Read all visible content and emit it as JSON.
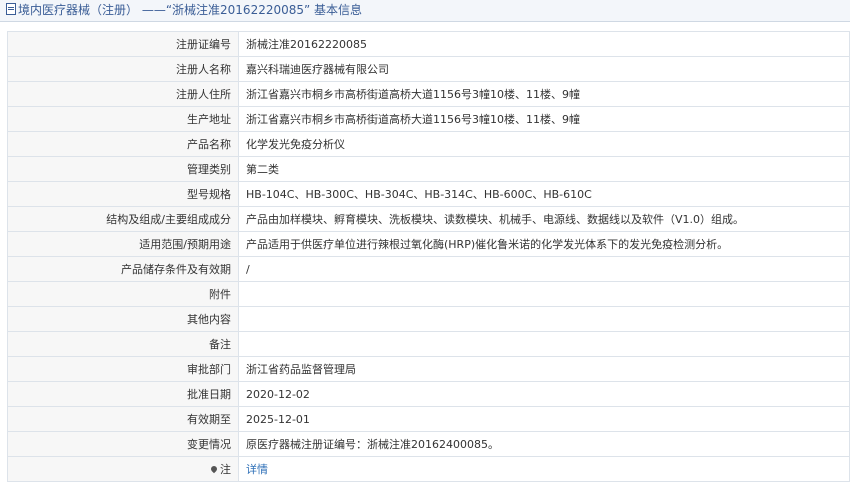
{
  "header": {
    "title": "境内医疗器械（注册） ——“浙械注准20162220085” 基本信息"
  },
  "rows": [
    {
      "label": "注册证编号",
      "value": "浙械注准20162220085"
    },
    {
      "label": "注册人名称",
      "value": "嘉兴科瑞迪医疗器械有限公司"
    },
    {
      "label": "注册人住所",
      "value": "浙江省嘉兴市桐乡市高桥街道高桥大道1156号3幢10楼、11楼、9幢"
    },
    {
      "label": "生产地址",
      "value": "浙江省嘉兴市桐乡市高桥街道高桥大道1156号3幢10楼、11楼、9幢"
    },
    {
      "label": "产品名称",
      "value": "化学发光免疫分析仪"
    },
    {
      "label": "管理类别",
      "value": "第二类"
    },
    {
      "label": "型号规格",
      "value": "HB-104C、HB-300C、HB-304C、HB-314C、HB-600C、HB-610C"
    },
    {
      "label": "结构及组成/主要组成成分",
      "value": "产品由加样模块、孵育模块、洗板模块、读数模块、机械手、电源线、数据线以及软件（V1.0）组成。"
    },
    {
      "label": "适用范围/预期用途",
      "value": "产品适用于供医疗单位进行辣根过氧化酶(HRP)催化鲁米诺的化学发光体系下的发光免疫检测分析。"
    },
    {
      "label": "产品储存条件及有效期",
      "value": "/"
    },
    {
      "label": "附件",
      "value": ""
    },
    {
      "label": "其他内容",
      "value": ""
    },
    {
      "label": "备注",
      "value": ""
    },
    {
      "label": "审批部门",
      "value": "浙江省药品监督管理局"
    },
    {
      "label": "批准日期",
      "value": "2020-12-02"
    },
    {
      "label": "有效期至",
      "value": "2025-12-01"
    },
    {
      "label": "变更情况",
      "value": "原医疗器械注册证编号：浙械注准20162400085。"
    }
  ],
  "note": {
    "label": "注",
    "icon": "pin-icon",
    "link_text": "详情"
  }
}
